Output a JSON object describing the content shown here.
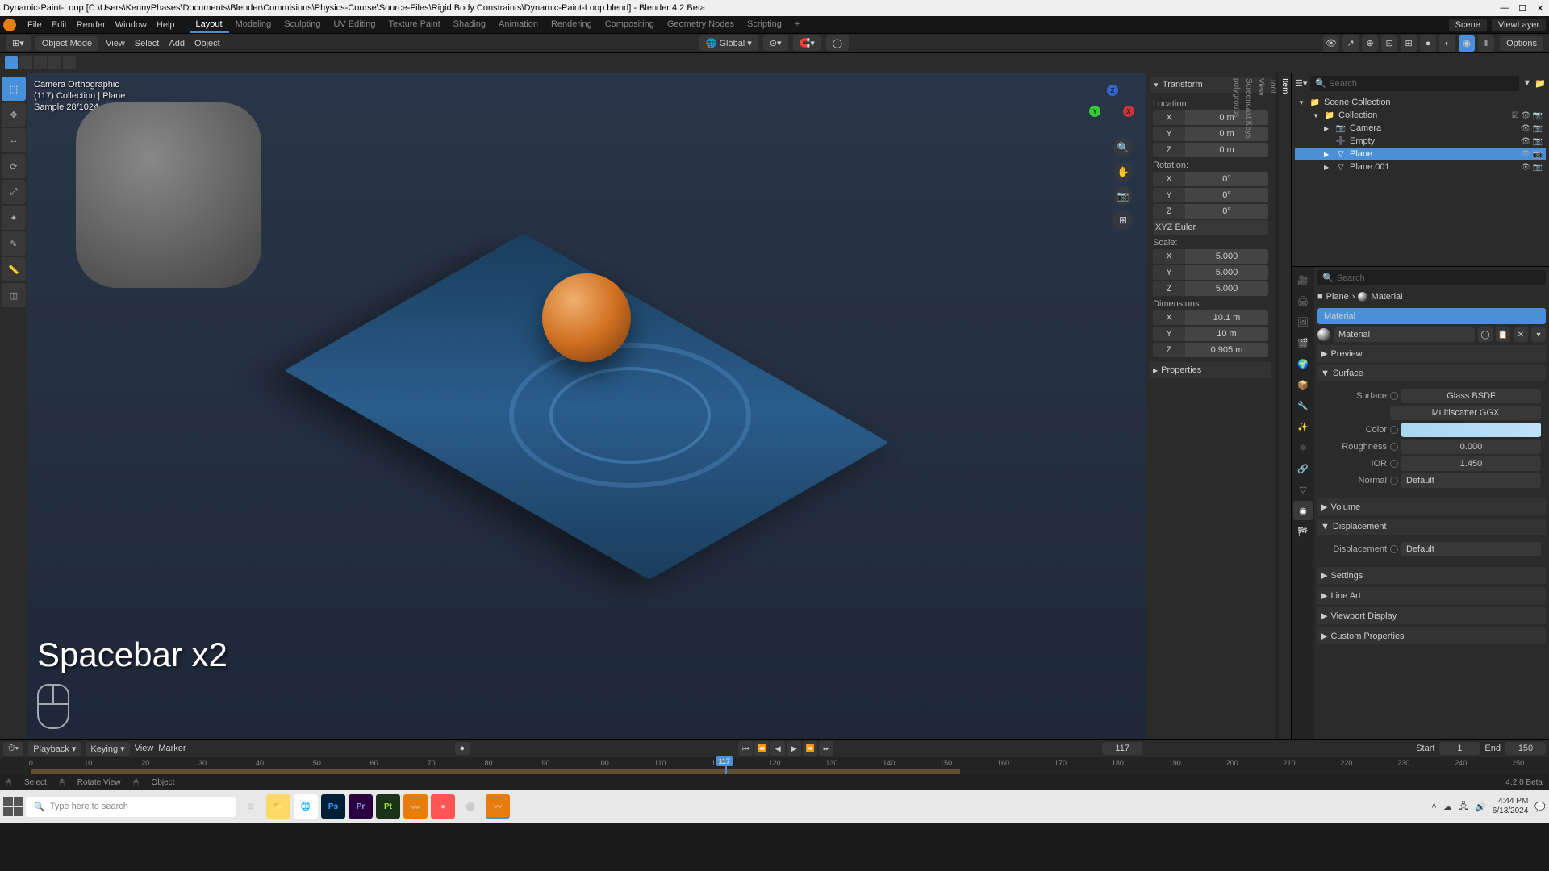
{
  "title_bar": {
    "text": "Dynamic-Paint-Loop [C:\\Users\\KennyPhases\\Documents\\Blender\\Commisions\\Physics-Course\\Source-Files\\Rigid Body Constraints\\Dynamic-Paint-Loop.blend] - Blender 4.2 Beta"
  },
  "menu": {
    "items": [
      "File",
      "Edit",
      "Render",
      "Window",
      "Help"
    ],
    "tabs": [
      "Layout",
      "Modeling",
      "Sculpting",
      "UV Editing",
      "Texture Paint",
      "Shading",
      "Animation",
      "Rendering",
      "Compositing",
      "Geometry Nodes",
      "Scripting"
    ],
    "active_tab": "Layout",
    "scene_label": "Scene",
    "viewlayer_label": "ViewLayer"
  },
  "toolbar": {
    "mode": "Object Mode",
    "menus": [
      "View",
      "Select",
      "Add",
      "Object"
    ],
    "orientation": "Global",
    "options_label": "Options"
  },
  "viewport": {
    "camera_label": "Camera Orthographic",
    "collection_label": "(117) Collection | Plane",
    "sample_label": "Sample 28/1024",
    "shortcut_overlay": "Spacebar x2"
  },
  "n_panel": {
    "tabs": [
      "Item",
      "Tool",
      "View",
      "Screencast Keys",
      "polygroups"
    ],
    "transform": {
      "header": "Transform",
      "location_label": "Location:",
      "location": {
        "X": "0 m",
        "Y": "0 m",
        "Z": "0 m"
      },
      "rotation_label": "Rotation:",
      "rotation": {
        "X": "0°",
        "Y": "0°",
        "Z": "0°"
      },
      "rotation_mode": "XYZ Euler",
      "scale_label": "Scale:",
      "scale": {
        "X": "5.000",
        "Y": "5.000",
        "Z": "5.000"
      },
      "dimensions_label": "Dimensions:",
      "dimensions": {
        "X": "10.1 m",
        "Y": "10 m",
        "Z": "0.905 m"
      }
    },
    "properties_header": "Properties"
  },
  "outliner": {
    "search_placeholder": "Search",
    "items": [
      {
        "name": "Scene Collection",
        "indent": 0,
        "icon": "📁"
      },
      {
        "name": "Collection",
        "indent": 1,
        "icon": "📁"
      },
      {
        "name": "Camera",
        "indent": 2,
        "icon": "📷"
      },
      {
        "name": "Empty",
        "indent": 2,
        "icon": "➕"
      },
      {
        "name": "Plane",
        "indent": 2,
        "icon": "▽",
        "selected": true
      },
      {
        "name": "Plane.001",
        "indent": 2,
        "icon": "▽"
      }
    ]
  },
  "properties": {
    "search_placeholder": "Search",
    "breadcrumb": {
      "object": "Plane",
      "material": "Material"
    },
    "material_slot": "Material",
    "material_name": "Material",
    "sections": {
      "preview": "Preview",
      "surface": "Surface",
      "volume": "Volume",
      "displacement": "Displacement",
      "settings": "Settings",
      "lineart": "Line Art",
      "viewport_display": "Viewport Display",
      "custom_properties": "Custom Properties"
    },
    "surface": {
      "shader_label": "Surface",
      "shader_value": "Glass BSDF",
      "distribution": "Multiscatter GGX",
      "color_label": "Color",
      "roughness_label": "Roughness",
      "roughness_value": "0.000",
      "ior_label": "IOR",
      "ior_value": "1.450",
      "normal_label": "Normal",
      "normal_value": "Default"
    },
    "displacement": {
      "label": "Displacement",
      "value": "Default"
    }
  },
  "timeline": {
    "menus": {
      "playback": "Playback",
      "keying": "Keying",
      "view": "View",
      "marker": "Marker"
    },
    "current_frame": "117",
    "start_label": "Start",
    "start_value": "1",
    "end_label": "End",
    "end_value": "150",
    "ticks": [
      "0",
      "10",
      "20",
      "30",
      "40",
      "50",
      "60",
      "70",
      "80",
      "90",
      "100",
      "110",
      "117",
      "120",
      "130",
      "140",
      "150",
      "160",
      "170",
      "180",
      "190",
      "200",
      "210",
      "220",
      "230",
      "240",
      "250"
    ]
  },
  "status_bar": {
    "select": "Select",
    "rotate": "Rotate View",
    "object": "Object",
    "version": "4.2.0 Beta"
  },
  "taskbar": {
    "search_placeholder": "Type here to search",
    "time": "4:44 PM",
    "date": "6/13/2024"
  }
}
